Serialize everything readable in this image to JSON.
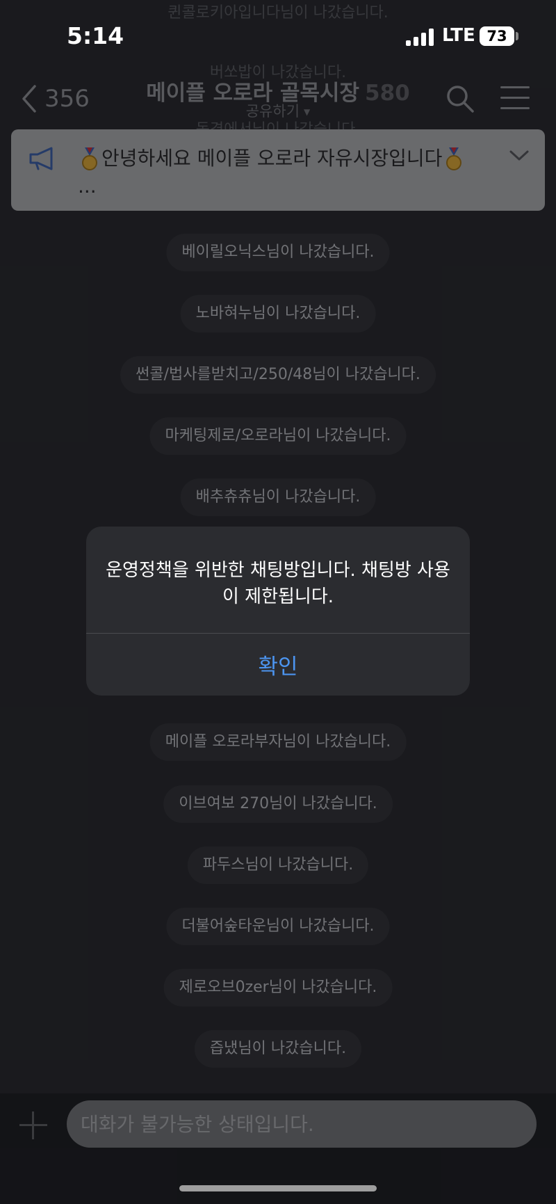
{
  "status_bar": {
    "time": "5:14",
    "network": "LTE",
    "battery": "73"
  },
  "header": {
    "back_count": "356",
    "room_title": "메이플 오로라 골목시장",
    "member_count": "580",
    "share_label": "공유하기"
  },
  "notice": {
    "line1": "안녕하세요 메이플 오로라 자유시장입니다",
    "line2": "...",
    "icons": [
      "megaphone-icon",
      "medal-icon",
      "chevron-down-icon"
    ]
  },
  "chat": {
    "ghost_top_messages": [
      "퀸콜로키아입니다님이 나갔습니다.",
      "버쏘밥이 나갔습니다.",
      "동경에서님이 나갔습니다."
    ],
    "messages": [
      "베이릴오닉스님이 나갔습니다.",
      "노바혀누님이 나갔습니다.",
      "썬콜/법사를받치고/250/48님이 나갔습니다.",
      "마케팅제로/오로라님이 나갔습니다.",
      "배추츄츄님이 나갔습니다.",
      "메이플 오로라부자님이 나갔습니다.",
      "이브여보 270님이 나갔습니다.",
      "파두스님이 나갔습니다.",
      "더불어숲타운님이 나갔습니다.",
      "제로오브0zer님이 나갔습니다.",
      "즙냈님이 나갔습니다."
    ]
  },
  "input": {
    "placeholder": "대화가 불가능한 상태입니다."
  },
  "dialog": {
    "message": "운영정책을 위반한 채팅방입니다. 채팅방 사용이 제한됩니다.",
    "confirm_label": "확인"
  },
  "colors": {
    "accent": "#4c95f0",
    "background": "#1b1c20",
    "dialog": "#2b2c30",
    "notice": "#aaabaf"
  }
}
